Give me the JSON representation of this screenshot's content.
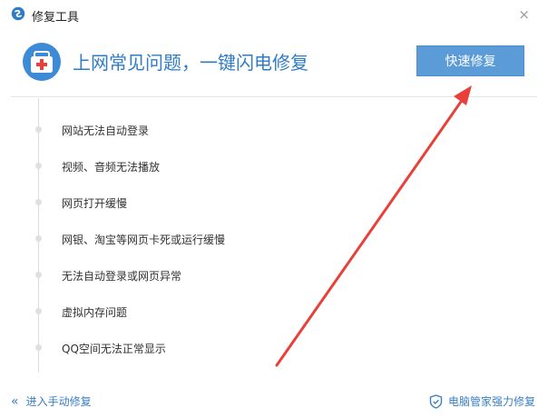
{
  "window": {
    "title": "修复工具",
    "close_glyph": "×"
  },
  "header": {
    "headline": "上网常见问题，一键闪电修复",
    "fix_button_label": "快速修复",
    "icon": "medical-kit-icon"
  },
  "issues": [
    "网站无法自动登录",
    "视频、音频无法播放",
    "网页打开缓慢",
    "网银、淘宝等网页卡死或运行缓慢",
    "无法自动登录或网页异常",
    "虚拟内存问题",
    "QQ空间无法正常显示"
  ],
  "footer": {
    "manual_link": "进入手动修复",
    "manual_icon": "double-chevron-left-icon",
    "strong_fix_link": "电脑管家强力修复",
    "strong_fix_icon": "shield-check-icon"
  },
  "colors": {
    "accent": "#2f7cc6",
    "button": "#5b9bd8",
    "annotation_arrow": "#e8413a"
  }
}
